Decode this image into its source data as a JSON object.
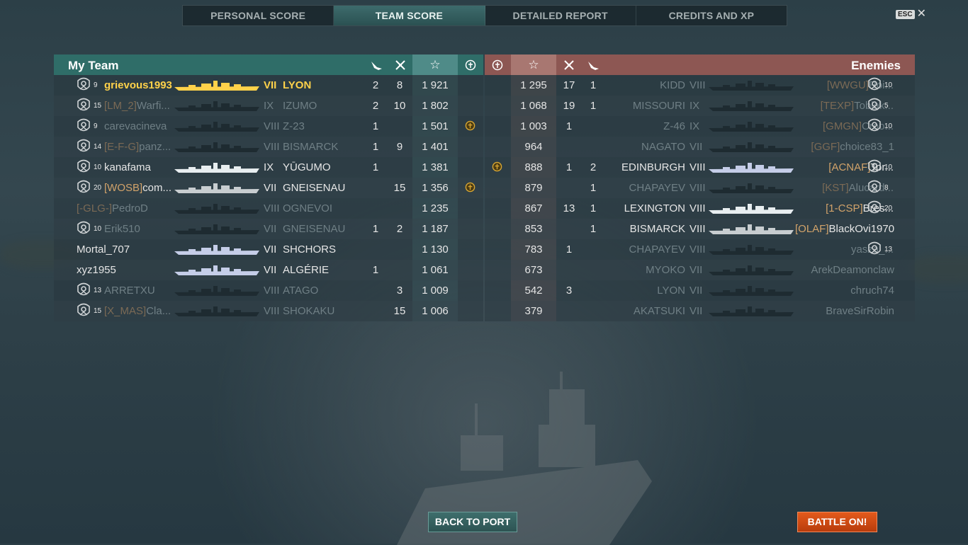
{
  "tabs": [
    "PERSONAL SCORE",
    "TEAM SCORE",
    "DETAILED REPORT",
    "CREDITS AND XP"
  ],
  "active_tab": "TEAM SCORE",
  "esc_label": "ESC",
  "my_team": {
    "title": "My Team",
    "rows": [
      {
        "lvl": "9",
        "clan": "",
        "name": "grievous1993",
        "tier": "VII",
        "ship": "LYON",
        "a": "2",
        "b": "8",
        "score": "1 921",
        "medal": false,
        "rank": true,
        "me": true,
        "dim": false,
        "color": "#ffd24a"
      },
      {
        "lvl": "15",
        "clan": "[LM_2]",
        "name": "Warfi...",
        "tier": "IX",
        "ship": "IZUMO",
        "a": "2",
        "b": "10",
        "score": "1 802",
        "medal": false,
        "rank": true,
        "me": false,
        "dim": true,
        "color": "#1e2b31"
      },
      {
        "lvl": "9",
        "clan": "",
        "name": "carevacineva",
        "tier": "VIII",
        "ship": "Z-23",
        "a": "1",
        "b": "",
        "score": "1 501",
        "medal": true,
        "rank": true,
        "me": false,
        "dim": true,
        "color": "#1e2b31"
      },
      {
        "lvl": "14",
        "clan": "[E-F-G]",
        "name": "panz...",
        "tier": "VIII",
        "ship": "BISMARCK",
        "a": "1",
        "b": "9",
        "score": "1 401",
        "medal": false,
        "rank": true,
        "me": false,
        "dim": true,
        "color": "#1e2b31"
      },
      {
        "lvl": "10",
        "clan": "",
        "name": "kanafama",
        "tier": "IX",
        "ship": "YŪGUMO",
        "a": "1",
        "b": "",
        "score": "1 381",
        "medal": false,
        "rank": true,
        "me": false,
        "dim": false,
        "color": "#e8eef0"
      },
      {
        "lvl": "20",
        "clan": "[WOSB]",
        "name": "com...",
        "tier": "VII",
        "ship": "GNEISENAU",
        "a": "",
        "b": "15",
        "score": "1 356",
        "medal": true,
        "rank": true,
        "me": false,
        "dim": false,
        "color": "#c8cdd0"
      },
      {
        "lvl": "",
        "clan": "[-GLG-]",
        "name": "PedroDestr...",
        "tier": "VIII",
        "ship": "OGNEVOI",
        "a": "",
        "b": "",
        "score": "1 235",
        "medal": false,
        "rank": false,
        "me": false,
        "dim": true,
        "color": "#1e2b31"
      },
      {
        "lvl": "10",
        "clan": "",
        "name": "Erik510",
        "tier": "VII",
        "ship": "GNEISENAU",
        "a": "1",
        "b": "2",
        "score": "1 187",
        "medal": false,
        "rank": true,
        "me": false,
        "dim": true,
        "color": "#1e2b31"
      },
      {
        "lvl": "",
        "clan": "",
        "name": "Mortal_707",
        "tier": "VII",
        "ship": "SHCHORS",
        "a": "",
        "b": "",
        "score": "1 130",
        "medal": false,
        "rank": false,
        "me": false,
        "dim": false,
        "color": "#c5cde8"
      },
      {
        "lvl": "",
        "clan": "",
        "name": "xyz1955",
        "tier": "VII",
        "ship": "ALGÉRIE",
        "a": "1",
        "b": "",
        "score": "1 061",
        "medal": false,
        "rank": false,
        "me": false,
        "dim": false,
        "color": "#c5cde8"
      },
      {
        "lvl": "13",
        "clan": "",
        "name": "ARRETXU",
        "tier": "VIII",
        "ship": "ATAGO",
        "a": "",
        "b": "3",
        "score": "1 009",
        "medal": false,
        "rank": true,
        "me": false,
        "dim": true,
        "color": "#1e2b31"
      },
      {
        "lvl": "15",
        "clan": "[X_MAS]",
        "name": "Cla...",
        "tier": "VIII",
        "ship": "SHOKAKU",
        "a": "",
        "b": "15",
        "score": "1 006",
        "medal": false,
        "rank": true,
        "me": false,
        "dim": true,
        "color": "#1e2b31"
      }
    ]
  },
  "enemies": {
    "title": "Enemies",
    "rows": [
      {
        "lvl": "10",
        "clan": "[WWGU]",
        "name": "Roi...",
        "tier": "VIII",
        "ship": "KIDD",
        "a": "17",
        "b": "1",
        "score": "1 295",
        "medal": false,
        "rank": true,
        "dim": true,
        "color": "#1e2b31"
      },
      {
        "lvl": "5",
        "clan": "[TEXP]",
        "name": "Toblak...",
        "tier": "IX",
        "ship": "MISSOURI",
        "a": "19",
        "b": "1",
        "score": "1 068",
        "medal": false,
        "rank": true,
        "dim": true,
        "color": "#1e2b31"
      },
      {
        "lvl": "10",
        "clan": "[GMGN]",
        "name": "Croo...",
        "tier": "IX",
        "ship": "Z-46",
        "a": "1",
        "b": "",
        "score": "1 003",
        "medal": false,
        "rank": true,
        "dim": true,
        "color": "#1e2b31"
      },
      {
        "lvl": "",
        "clan": "[GGF]",
        "name": "choice83_1",
        "tier": "VII",
        "ship": "NAGATO",
        "a": "",
        "b": "",
        "score": "964",
        "medal": false,
        "rank": false,
        "dim": true,
        "color": "#1e2b31"
      },
      {
        "lvl": "10",
        "clan": "[ACNAF]",
        "name": "Tor...",
        "tier": "VIII",
        "ship": "EDINBURGH",
        "a": "1",
        "b": "2",
        "score": "888",
        "medal": true,
        "rank": true,
        "dim": false,
        "color": "#c5cde8"
      },
      {
        "lvl": "8",
        "clan": "[KST]",
        "name": "Alucard...",
        "tier": "VIII",
        "ship": "CHAPAYEV",
        "a": "",
        "b": "1",
        "score": "879",
        "medal": false,
        "rank": true,
        "dim": true,
        "color": "#1e2b31"
      },
      {
        "lvl": "20",
        "clan": "[1-CSP]",
        "name": "Bres...",
        "tier": "VIII",
        "ship": "LEXINGTON",
        "a": "13",
        "b": "1",
        "score": "867",
        "medal": false,
        "rank": true,
        "dim": false,
        "color": "#e8eef0"
      },
      {
        "lvl": "",
        "clan": "[OLAF]",
        "name": "BlackOvi1970",
        "tier": "VIII",
        "ship": "BISMARCK",
        "a": "",
        "b": "1",
        "score": "853",
        "medal": false,
        "rank": false,
        "dim": false,
        "color": "#c8cdd0"
      },
      {
        "lvl": "13",
        "clan": "",
        "name": "yasza_...",
        "tier": "VIII",
        "ship": "CHAPAYEV",
        "a": "1",
        "b": "",
        "score": "783",
        "medal": false,
        "rank": true,
        "dim": true,
        "color": "#1e2b31"
      },
      {
        "lvl": "",
        "clan": "",
        "name": "ArekDeamonclaw",
        "tier": "VII",
        "ship": "MYOKO",
        "a": "",
        "b": "",
        "score": "673",
        "medal": false,
        "rank": false,
        "dim": true,
        "color": "#1e2b31"
      },
      {
        "lvl": "",
        "clan": "",
        "name": "chruch74",
        "tier": "VII",
        "ship": "LYON",
        "a": "3",
        "b": "",
        "score": "542",
        "medal": false,
        "rank": false,
        "dim": true,
        "color": "#1e2b31"
      },
      {
        "lvl": "",
        "clan": "",
        "name": "BraveSirRobin",
        "tier": "VII",
        "ship": "AKATSUKI",
        "a": "",
        "b": "",
        "score": "379",
        "medal": false,
        "rank": false,
        "dim": true,
        "color": "#1e2b31"
      }
    ]
  },
  "buttons": {
    "back": "BACK TO PORT",
    "battle": "BATTLE ON!"
  }
}
